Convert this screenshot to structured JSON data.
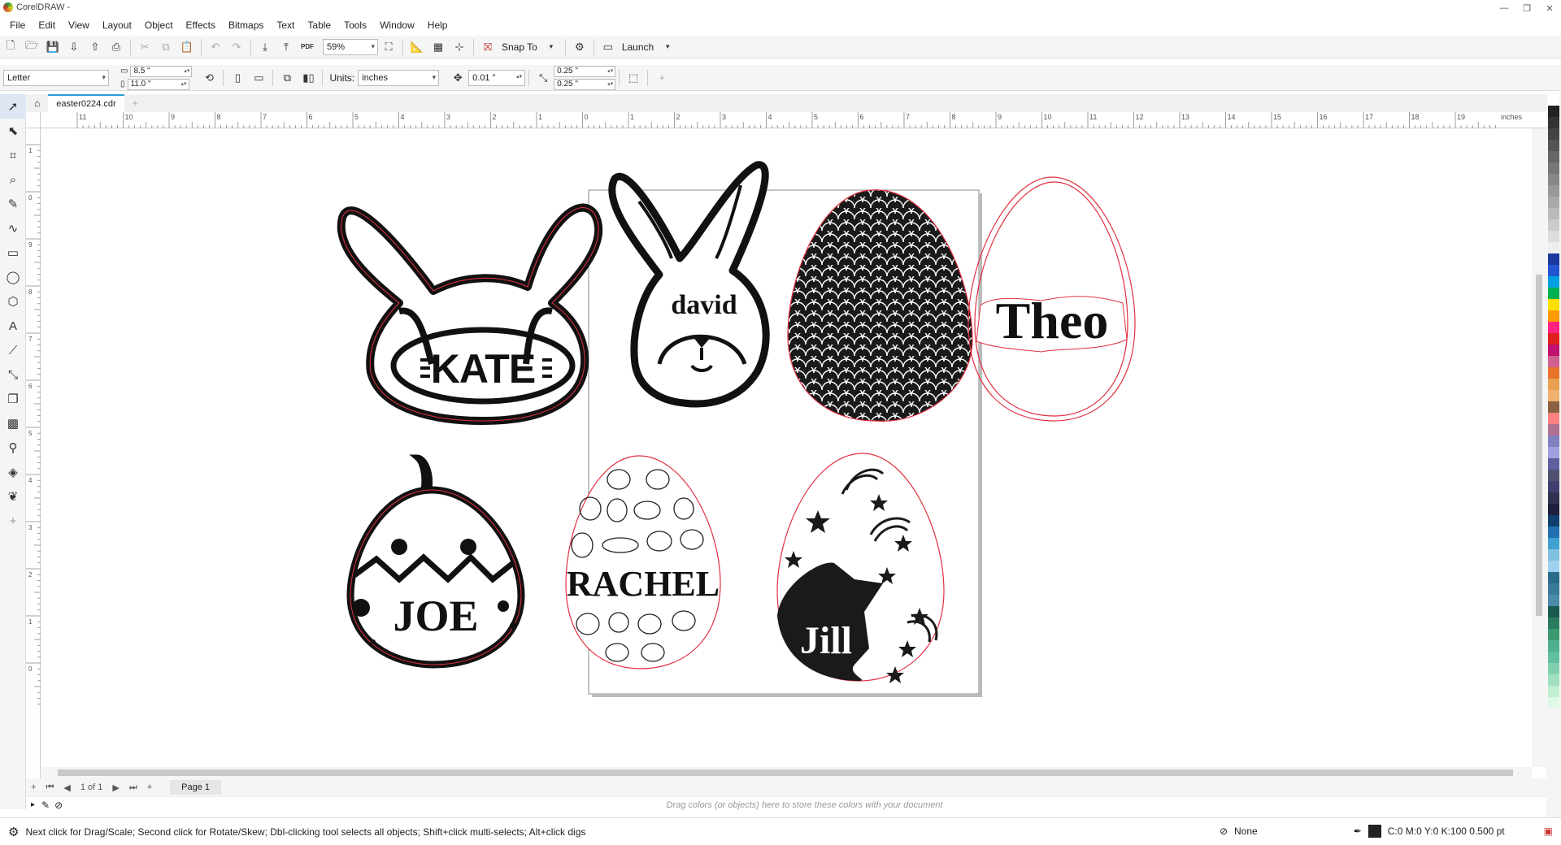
{
  "window": {
    "title": "CorelDRAW -",
    "minimize": "—",
    "restore": "❐",
    "close": "✕"
  },
  "menu": [
    "File",
    "Edit",
    "View",
    "Layout",
    "Object",
    "Effects",
    "Bitmaps",
    "Text",
    "Table",
    "Tools",
    "Window",
    "Help"
  ],
  "toolbar": {
    "zoom": "59%",
    "snap_to": "Snap To",
    "launch": "Launch"
  },
  "property_bar": {
    "page_size": "Letter",
    "width": "8.5 \"",
    "height": "11.0 \"",
    "units_label": "Units:",
    "units": "inches",
    "nudge": "0.01 \"",
    "dup_x": "0.25 \"",
    "dup_y": "0.25 \""
  },
  "document": {
    "tab_name": "easter0224.cdr"
  },
  "ruler": {
    "unit": "inches",
    "labels": [
      "11",
      "10",
      "9",
      "8",
      "7",
      "6",
      "5",
      "4",
      "3",
      "2",
      "1",
      "0",
      "1",
      "2",
      "3",
      "4",
      "5",
      "6",
      "7",
      "8",
      "9",
      "10",
      "11",
      "12",
      "13",
      "14",
      "15",
      "16",
      "17",
      "18",
      "19"
    ],
    "v_labels": [
      "1",
      "0",
      "9",
      "8",
      "7",
      "6",
      "5",
      "4",
      "3",
      "2",
      "1",
      "0"
    ]
  },
  "artwork": {
    "names": [
      "KATE",
      "david",
      "Theo",
      "JOE",
      "RACHEL",
      "Jill"
    ],
    "fill": "#1a1a1a",
    "outline": "#e03040"
  },
  "pager": {
    "of": "1 of 1",
    "page_tab": "Page 1"
  },
  "colorbar": {
    "hint": "Drag colors (or objects) here to store these colors with your document"
  },
  "status": {
    "message": "Next click for Drag/Scale; Second click for Rotate/Skew; Dbl-clicking tool selects all objects; Shift+click multi-selects; Alt+click digs",
    "fill": "None",
    "outline": "C:0 M:0 Y:0 K:100  0.500 pt"
  },
  "palette_colors": [
    "#ffffff",
    "#222222",
    "#333333",
    "#444444",
    "#555555",
    "#666666",
    "#777777",
    "#888888",
    "#999999",
    "#aaaaaa",
    "#bbbbbb",
    "#cccccc",
    "#dddddd",
    "#eeeeee",
    "#1a3aa0",
    "#2255d0",
    "#00a0e0",
    "#00b050",
    "#ffe000",
    "#ff9900",
    "#ff2080",
    "#e02020",
    "#c01070",
    "#d06090",
    "#e8742c",
    "#e8a050",
    "#f0b070",
    "#8a6040",
    "#ff8080",
    "#b07090",
    "#8080c0",
    "#a0a0e0",
    "#6060a0",
    "#505070",
    "#404070",
    "#303050",
    "#202040",
    "#104070",
    "#2070b0",
    "#40a0d0",
    "#80c0e0",
    "#a0d0f0",
    "#2a6a8a",
    "#3a7a9a",
    "#4a8aaa",
    "#1a5a50",
    "#2a7a60",
    "#3a9a70",
    "#50b090",
    "#60c0a0",
    "#80d0b0",
    "#a0e0c0",
    "#c0f0d0",
    "#e0f8e8"
  ]
}
